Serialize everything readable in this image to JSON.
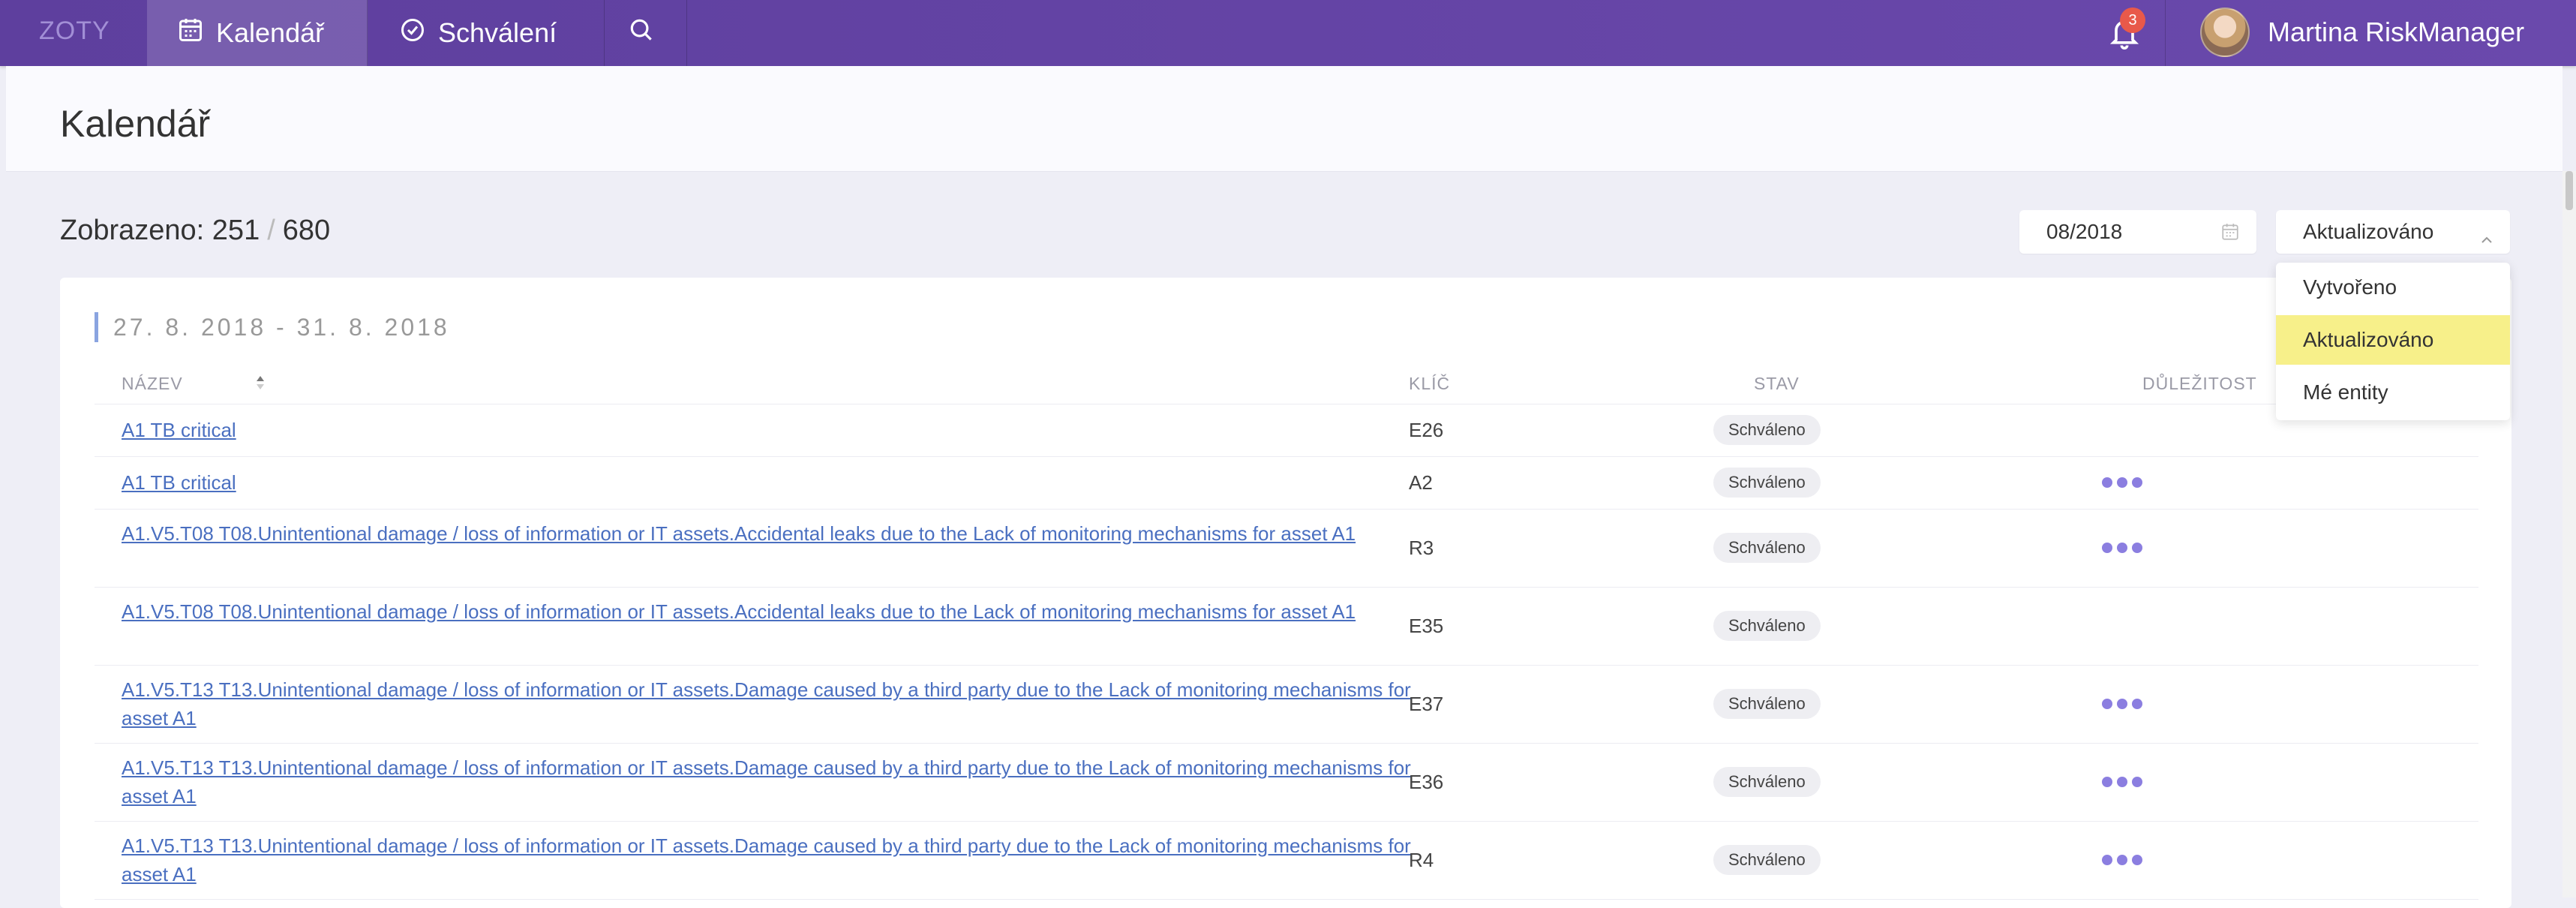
{
  "nav": {
    "brand": "ZOTY",
    "items": [
      {
        "label": "Kalendář",
        "icon": "calendar-icon",
        "active": true
      },
      {
        "label": "Schválení",
        "icon": "check-circle-icon",
        "active": false
      }
    ],
    "search_icon": "search-icon",
    "notifications": {
      "icon": "bell-icon",
      "count": "3"
    },
    "user": {
      "name": "Martina RiskManager",
      "avatar": "avatar"
    }
  },
  "page": {
    "title": "Kalendář"
  },
  "counter": {
    "label": "Zobrazeno:",
    "shown": "251",
    "total": "680"
  },
  "filters": {
    "date_value": "08/2018",
    "sort_selected": "Aktualizováno",
    "sort_options": [
      "Vytvořeno",
      "Aktualizováno",
      "Mé entity"
    ]
  },
  "section": {
    "title": "27. 8. 2018 - 31. 8. 2018"
  },
  "table": {
    "columns": [
      "NÁZEV",
      "KLÍČ",
      "STAV",
      "DŮLEŽITOST"
    ],
    "rows": [
      {
        "name": "A1 TB critical",
        "key": "E26",
        "status": "Schváleno",
        "importance": 0
      },
      {
        "name": "A1 TB critical",
        "key": "A2",
        "status": "Schváleno",
        "importance": 3
      },
      {
        "name": "A1.V5.T08 T08.Unintentional damage / loss of information or IT assets.Accidental leaks due to the Lack of monitoring mechanisms for asset A1",
        "key": "R3",
        "status": "Schváleno",
        "importance": 3
      },
      {
        "name": "A1.V5.T08 T08.Unintentional damage / loss of information or IT assets.Accidental leaks due to the Lack of monitoring mechanisms for asset A1",
        "key": "E35",
        "status": "Schváleno",
        "importance": 0
      },
      {
        "name": "A1.V5.T13 T13.Unintentional damage / loss of information or IT assets.Damage caused by a third party due to the Lack of monitoring mechanisms for asset A1",
        "key": "E37",
        "status": "Schváleno",
        "importance": 3
      },
      {
        "name": "A1.V5.T13 T13.Unintentional damage / loss of information or IT assets.Damage caused by a third party due to the Lack of monitoring mechanisms for asset A1",
        "key": "E36",
        "status": "Schváleno",
        "importance": 3
      },
      {
        "name": "A1.V5.T13 T13.Unintentional damage / loss of information or IT assets.Damage caused by a third party due to the Lack of monitoring mechanisms for asset A1",
        "key": "R4",
        "status": "Schváleno",
        "importance": 3
      }
    ]
  },
  "colors": {
    "topbar": "#6a49ac",
    "link": "#4a6fc0",
    "highlight": "#f7f08a",
    "importance_dot": "#8b7ee0",
    "badge": "#e8594a"
  }
}
